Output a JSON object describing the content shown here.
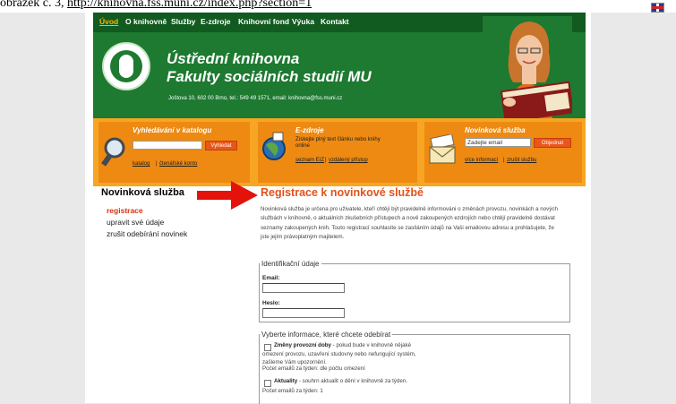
{
  "top_line": {
    "prefix": "obrázek č. 3,",
    "url": "http://knihovna.fss.muni.cz/index.php?section=1"
  },
  "nav": [
    "Úvod",
    "O knihovně",
    "Služby",
    "E-zdroje",
    "Knihovní fond",
    "Výuka",
    "Kontakt"
  ],
  "header": {
    "title_line1": "Ústřední knihovna",
    "title_line2": "Fakulty sociálních studií MU",
    "address": "Joštova 10, 602 00 Brno, tel.: 549 49 1571, email: knihovna@fss.muni.cz"
  },
  "boxes": {
    "catalog": {
      "title": "Vyhledávání v katalogu",
      "button": "Vyhledat",
      "link1": "katalog",
      "link2": "čtenářské konto"
    },
    "ezdroje": {
      "title": "E-zdroje",
      "text": "Získejte plný text článku nebo knihy online",
      "link1": "seznam EIZ",
      "link2": "vzdálený přístup"
    },
    "newsletter": {
      "title": "Novinková služba",
      "input_value": "Zadejte email",
      "button": "Objednat",
      "link1": "více informací",
      "link2": "zrušit službu"
    }
  },
  "sidebar": {
    "title": "Novinková služba",
    "items": [
      "registrace",
      "upravit své údaje",
      "zrušit odebírání novinek"
    ]
  },
  "main": {
    "title": "Registrace k novinkové službě",
    "intro": "Novinková služba je určena pro uživatele, kteří chtějí být pravidelně informováni o změnách provozu, novinkách a nových službách v knihovně, o aktuálních zkušebních přístupech a nově zakoupených ezdrojích nebo chtějí pravidelně dostávat seznamy zakoupených knih. Touto registrací souhlasíte se zasíláním údajů na Vaši emailovou adresu a prohlašujete, že jste jejím právoplatným majitelem.",
    "ident": {
      "legend": "Identifikační údaje",
      "email_label": "Email:",
      "password_label": "Heslo:"
    },
    "options": {
      "legend": "Vyberte informace, které chcete odebírat",
      "opt1_title": "Změny provozní doby",
      "opt1_text": " - pokud bude v knihovně nějaké omezení provozu, uzavření studovny nebo nefungující systém, zašleme Vám upozornění.",
      "opt1_count": "Počet emailů za týden: dle počtu omezení",
      "opt2_title": "Aktuality",
      "opt2_text": " - souhrn aktualit o dění v knihovně za týden.",
      "opt2_count": "Počet emailů za týden: 1"
    }
  }
}
